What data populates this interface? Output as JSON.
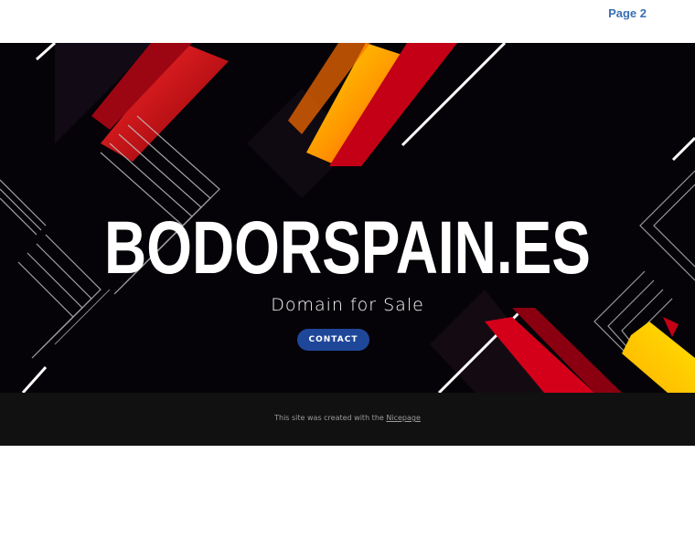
{
  "header": {
    "nav_link": "Page 2"
  },
  "hero": {
    "title": "BODORSPAIN.ES",
    "subtitle": "Domain for Sale",
    "contact_button": "CONTACT"
  },
  "footer": {
    "text": "This site was created with the",
    "link": "Nicepage"
  },
  "colors": {
    "accent_blue": "#1f4799",
    "nav_blue": "#3b6fb6",
    "hero_bg": "#050307",
    "footer_bg": "#111111"
  }
}
